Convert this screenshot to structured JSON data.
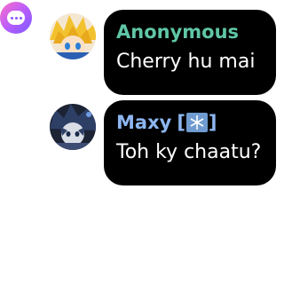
{
  "colors": {
    "bubble_bg": "#000000",
    "message_text": "#ffffff",
    "anonymous_name": "#5fc6a6",
    "maxy_name": "#8db6f0"
  },
  "app_icon": {
    "icon": "chat-bubble-icon"
  },
  "messages": [
    {
      "avatar_icon": "anime-character-avatar-blonde",
      "name": "Anonymous",
      "text": "Cherry hu mai"
    },
    {
      "avatar_icon": "anime-character-avatar-dark-hair",
      "name": "Maxy",
      "badge_open": "[",
      "badge_close": "]",
      "badge_icon": "snowflake-icon",
      "text": "Toh ky chaatu?"
    }
  ]
}
